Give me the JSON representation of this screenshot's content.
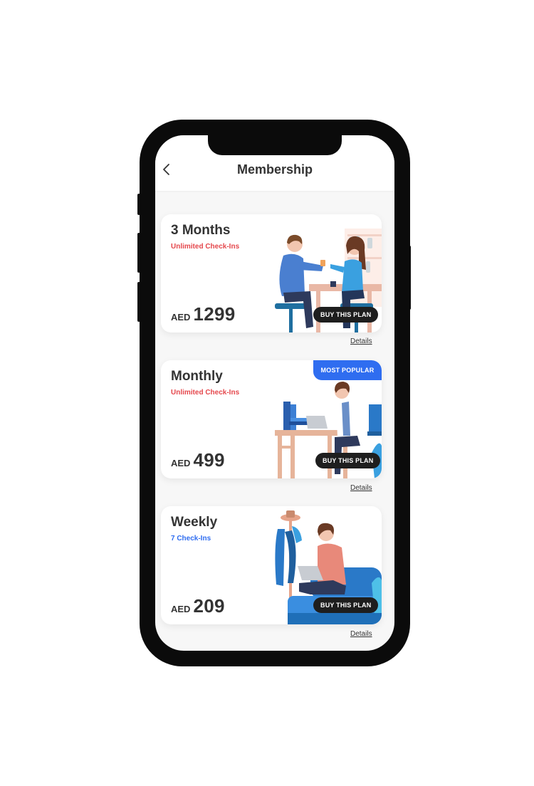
{
  "header": {
    "title": "Membership",
    "back_icon": "chevron-left-icon"
  },
  "accent_colors": {
    "red": "#e5484d",
    "blue": "#2f6df0",
    "badge": "#2f6df0",
    "button": "#1e1e1e"
  },
  "plans": [
    {
      "name": "3 Months",
      "subtitle": "Unlimited Check-Ins",
      "currency": "AED",
      "price": "1299",
      "buy_label": "BUY THIS PLAN",
      "details_label": "Details",
      "illustration": "cafe-couple-illustration"
    },
    {
      "name": "Monthly",
      "subtitle": "Unlimited Check-Ins",
      "currency": "AED",
      "price": "499",
      "badge": "MOST POPULAR",
      "buy_label": "BUY THIS PLAN",
      "details_label": "Details",
      "illustration": "desk-worker-illustration"
    },
    {
      "name": "Weekly",
      "subtitle": "7 Check-Ins",
      "currency": "AED",
      "price": "209",
      "buy_label": "BUY THIS PLAN",
      "details_label": "Details",
      "illustration": "sofa-laptop-illustration"
    }
  ]
}
